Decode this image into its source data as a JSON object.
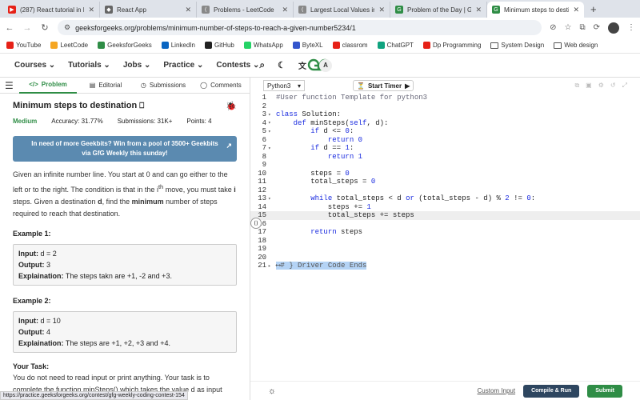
{
  "browser": {
    "tabs": [
      {
        "title": "(287) React tutorial in Hin",
        "color": "#e62117",
        "glyph": "▶"
      },
      {
        "title": "React App",
        "color": "#666666",
        "glyph": "◆"
      },
      {
        "title": "Problems - LeetCode",
        "color": "#888888",
        "glyph": "⟨"
      },
      {
        "title": "Largest Local Values in a",
        "color": "#888888",
        "glyph": "⟨"
      },
      {
        "title": "Problem of the Day | Geek",
        "color": "#2f8d46",
        "glyph": "G"
      },
      {
        "title": "Minimum steps to destin",
        "color": "#2f8d46",
        "glyph": "G"
      }
    ],
    "url": "geeksforgeeks.org/problems/minimum-number-of-steps-to-reach-a-given-number5234/1",
    "bookmarks": [
      {
        "label": "YouTube",
        "color": "#e62117"
      },
      {
        "label": "LeetCode",
        "color": "#f5a623"
      },
      {
        "label": "GeeksforGeeks",
        "color": "#2f8d46"
      },
      {
        "label": "LinkedIn",
        "color": "#0a66c2"
      },
      {
        "label": "GitHub",
        "color": "#222222"
      },
      {
        "label": "WhatsApp",
        "color": "#25d366"
      },
      {
        "label": "ByteXL",
        "color": "#3355cc"
      },
      {
        "label": "classrom",
        "color": "#e62117"
      },
      {
        "label": "ChatGPT",
        "color": "#10a37f"
      },
      {
        "label": "Dp Programming",
        "color": "#e62117"
      },
      {
        "label": "System Design",
        "color": "folder"
      },
      {
        "label": "Web design",
        "color": "folder"
      }
    ],
    "status_url": "https://practice.geeksforgeeks.org/contest/gfg-weekly-coding-contest-154"
  },
  "gfg": {
    "menu": [
      "Courses",
      "Tutorials",
      "Jobs",
      "Practice",
      "Contests"
    ],
    "avatar": "A"
  },
  "left": {
    "tabs": [
      "Problem",
      "Editorial",
      "Submissions",
      "Comments"
    ],
    "title": "Minimum steps to destination",
    "difficulty": "Medium",
    "accuracy": "Accuracy: 31.77%",
    "submissions": "Submissions: 31K+",
    "points": "Points: 4",
    "banner": "In need of more Geekbits? Win from a pool of 3500+ Geekbits via GfG Weekly this sunday!",
    "desc": {
      "p1": "Given an infinite number line. You start at 0 and can go either to the left or to the right. The condition is that in the i",
      "sup": "th",
      "p2": " move, you must take ",
      "i": "i",
      "p3": " steps. Given a destination ",
      "d": "d",
      "p4": ", find the ",
      "min": "minimum",
      "p5": " number of steps required to reach that destination."
    },
    "examples": [
      {
        "head": "Example 1:",
        "input": "d = 2",
        "output": "3",
        "explanation": "The steps takn are +1, -2 and +3."
      },
      {
        "head": "Example 2:",
        "input": "d = 10",
        "output": "4",
        "explanation": "The steps are +1, +2, +3 and +4."
      }
    ],
    "labels": {
      "input": "Input:",
      "output": "Output:",
      "explanation": "Explaination:"
    },
    "task_head": "Your Task:",
    "task": "You do not need to read input or print anything. Your task is to complete the function minSteps() which takes the value d as input parameter and returns"
  },
  "editor": {
    "language": "Python3",
    "timer": "Start Timer",
    "lines": [
      {
        "n": "1",
        "fold": "",
        "html": "<span class='cm'>#User function Template for python3</span>"
      },
      {
        "n": "2",
        "fold": "",
        "html": ""
      },
      {
        "n": "3",
        "fold": "▾",
        "html": "<span class='kw'>class</span> Solution:"
      },
      {
        "n": "4",
        "fold": "▾",
        "html": "    <span class='kw'>def</span> minSteps(<span class='kw'>self</span>, d):"
      },
      {
        "n": "5",
        "fold": "▾",
        "html": "        <span class='kw'>if</span> d <= <span class='num'>0</span>:"
      },
      {
        "n": "6",
        "fold": "",
        "html": "            <span class='kw'>return</span> <span class='num'>0</span>"
      },
      {
        "n": "7",
        "fold": "▾",
        "html": "        <span class='kw'>if</span> d == <span class='num'>1</span>:"
      },
      {
        "n": "8",
        "fold": "",
        "html": "            <span class='kw'>return</span> <span class='num'>1</span>"
      },
      {
        "n": "9",
        "fold": "",
        "html": ""
      },
      {
        "n": "10",
        "fold": "",
        "html": "        steps = <span class='num'>0</span>"
      },
      {
        "n": "11",
        "fold": "",
        "html": "        total_steps = <span class='num'>0</span>"
      },
      {
        "n": "12",
        "fold": "",
        "html": ""
      },
      {
        "n": "13",
        "fold": "▾",
        "html": "        <span class='kw'>while</span> total_steps < d <span class='kw'>or</span> (total_steps - d) % <span class='num'>2</span> != <span class='num'>0</span>:"
      },
      {
        "n": "14",
        "fold": "",
        "html": "            steps += <span class='num'>1</span>"
      },
      {
        "n": "15",
        "fold": "",
        "html": "            total_steps += steps",
        "current": true
      },
      {
        "n": "16",
        "fold": "",
        "html": ""
      },
      {
        "n": "17",
        "fold": "",
        "html": "        <span class='kw'>return</span> steps"
      },
      {
        "n": "18",
        "fold": "",
        "html": ""
      },
      {
        "n": "19",
        "fold": "",
        "html": ""
      },
      {
        "n": "20",
        "fold": "",
        "html": ""
      },
      {
        "n": "21",
        "fold": "▸",
        "html": "<span class='sel'>⟷# } Driver Code Ends</span>"
      }
    ],
    "custom_input": "Custom Input",
    "compile_run": "Compile & Run",
    "submit": "Submit"
  }
}
